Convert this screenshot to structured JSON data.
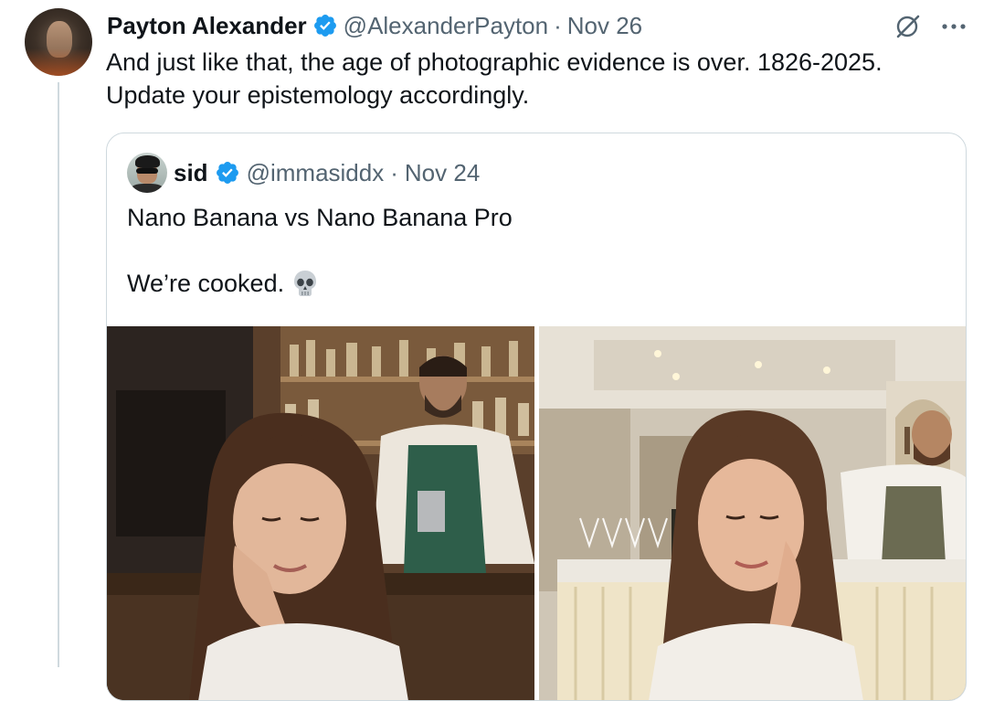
{
  "tweet": {
    "author_name": "Payton Alexander",
    "author_handle": "@AlexanderPayton",
    "separator": "·",
    "date": "Nov 26",
    "text_line1": "And just like that, the age of photographic evidence is over. 1826-2025.",
    "text_line2": "Update your epistemology accordingly.",
    "icons": {
      "verified": "verified-badge-icon",
      "grok": "grok-icon",
      "more": "more-options-icon",
      "avatar": "avatar"
    }
  },
  "quote": {
    "author_name": "sid",
    "author_handle": "@immasiddx",
    "separator": "·",
    "date": "Nov 24",
    "text_line1": "Nano Banana vs Nano Banana Pro",
    "text_line2": "We’re cooked.",
    "emoji": "skull-emoji",
    "media": [
      {
        "name": "left-photo",
        "depicts": "woman-at-bar-with-bartender"
      },
      {
        "name": "right-photo",
        "depicts": "woman-in-restaurant-with-bartender"
      }
    ]
  },
  "colors": {
    "text_primary": "#0f1419",
    "text_secondary": "#536471",
    "verified_blue": "#1d9bf0",
    "border": "#cfd9de"
  }
}
